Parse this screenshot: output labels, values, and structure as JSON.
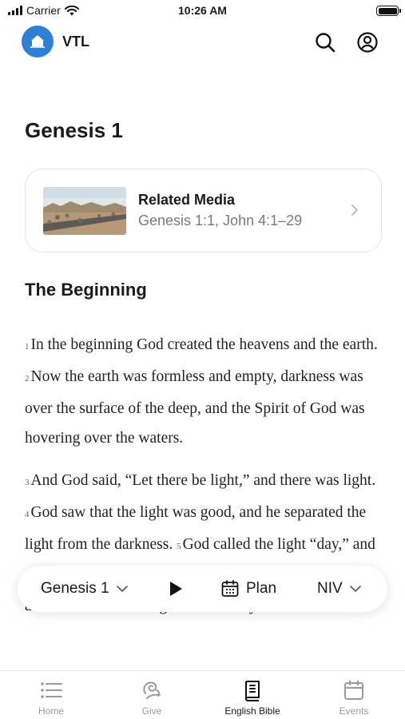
{
  "status_bar": {
    "carrier": "Carrier",
    "time": "10:26 AM"
  },
  "header": {
    "app_name": "VTL"
  },
  "chapter_title": "Genesis 1",
  "related_media": {
    "title": "Related Media",
    "subtitle": "Genesis 1:1, John 4:1–29"
  },
  "section_heading": "The Beginning",
  "verses": {
    "v1_num": "1",
    "v1_text": "In the beginning God created the heavens and the earth.",
    "v2_num": "2",
    "v2_text": "Now the earth was formless and empty, darkness was over the surface of the deep, and the Spirit of God was hovering over the waters.",
    "v3_num": "3",
    "v3_text": "And God said, “Let there be light,” and there was light.",
    "v4_num": "4",
    "v4_text": "God saw that the light was good, and he separated the light from the darkness.",
    "v5_num": "5",
    "v5_text": "God called the light “day,” and the darkness he called “night.” And there was evening, and there was morning—the first day."
  },
  "reader_bar": {
    "chapter": "Genesis 1",
    "plan": "Plan",
    "version": "NIV"
  },
  "tabs": [
    {
      "label": "Home",
      "icon": "list-icon",
      "active": false
    },
    {
      "label": "Give",
      "icon": "give-icon",
      "active": false
    },
    {
      "label": "English Bible",
      "icon": "bible-icon",
      "active": true
    },
    {
      "label": "Events",
      "icon": "calendar-icon",
      "active": false
    }
  ],
  "colors": {
    "brand": "#2f7fd6",
    "text": "#1a1a1a",
    "muted": "#7a7a7a",
    "tab_inactive": "#9a9a9a"
  }
}
